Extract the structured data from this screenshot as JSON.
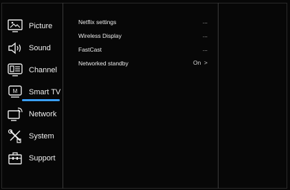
{
  "sidebar": {
    "items": [
      {
        "label": "Picture",
        "icon": "picture-icon"
      },
      {
        "label": "Sound",
        "icon": "speaker-icon"
      },
      {
        "label": "Channel",
        "icon": "channel-icon"
      },
      {
        "label": "Smart TV",
        "icon": "smart-tv-icon"
      },
      {
        "label": "Network",
        "icon": "network-icon"
      },
      {
        "label": "System",
        "icon": "tools-icon"
      },
      {
        "label": "Support",
        "icon": "toolbox-icon"
      }
    ],
    "active_index": 3,
    "accent_color": "#3aa0ff"
  },
  "settings": {
    "rows": [
      {
        "name": "Netflix settings",
        "value": "..."
      },
      {
        "name": "Wireless Display",
        "value": "..."
      },
      {
        "name": "FastCast",
        "value": "..."
      },
      {
        "name": "Networked standby",
        "value": "On  >"
      }
    ]
  }
}
